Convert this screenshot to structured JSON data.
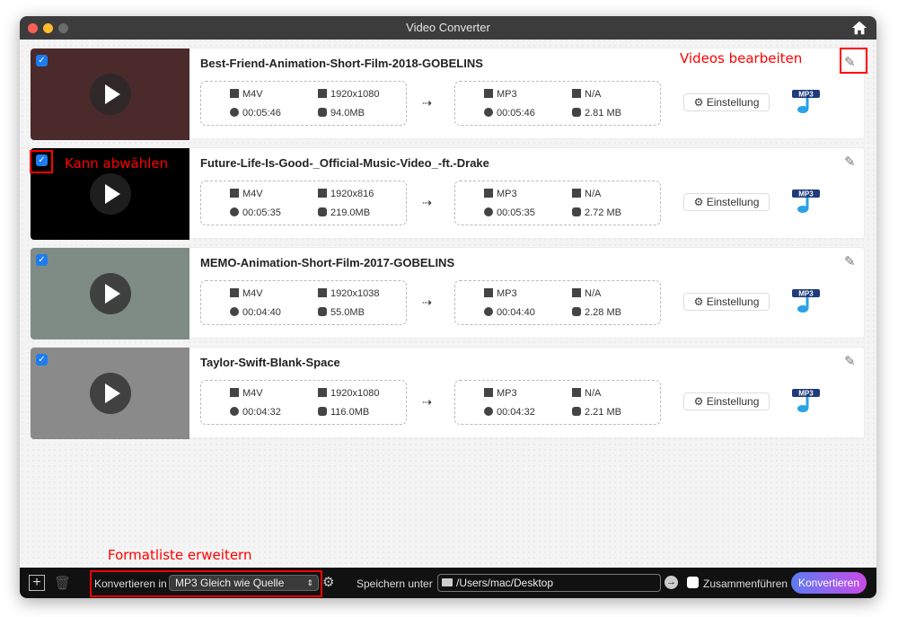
{
  "window": {
    "title": "Video Converter"
  },
  "items": [
    {
      "title": "Best-Friend-Animation-Short-Film-2018-GOBELINS",
      "src": {
        "format": "M4V",
        "resolution": "1920x1080",
        "duration": "00:05:46",
        "size": "94.0MB"
      },
      "dst": {
        "format": "MP3",
        "resolution": "N/A",
        "duration": "00:05:46",
        "size": "2.81 MB"
      },
      "thumb_color": "#4a2a2a"
    },
    {
      "title": "Future-Life-Is-Good-_Official-Music-Video_-ft.-Drake",
      "src": {
        "format": "M4V",
        "resolution": "1920x816",
        "duration": "00:05:35",
        "size": "219.0MB"
      },
      "dst": {
        "format": "MP3",
        "resolution": "N/A",
        "duration": "00:05:35",
        "size": "2.72 MB"
      },
      "thumb_color": "#000000"
    },
    {
      "title": "MEMO-Animation-Short-Film-2017-GOBELINS",
      "src": {
        "format": "M4V",
        "resolution": "1920x1038",
        "duration": "00:04:40",
        "size": "55.0MB"
      },
      "dst": {
        "format": "MP3",
        "resolution": "N/A",
        "duration": "00:04:40",
        "size": "2.28 MB"
      },
      "thumb_color": "#7f8c86"
    },
    {
      "title": "Taylor-Swift-Blank-Space",
      "src": {
        "format": "M4V",
        "resolution": "1920x1080",
        "duration": "00:04:32",
        "size": "116.0MB"
      },
      "dst": {
        "format": "MP3",
        "resolution": "N/A",
        "duration": "00:04:32",
        "size": "2.21 MB"
      },
      "thumb_color": "#8a8a8a"
    }
  ],
  "settings_label": "Einstellung",
  "mp3_badge": "MP3",
  "annotations": {
    "edit": "Videos bearbeiten",
    "uncheck": "Kann abwählen",
    "formats": "Formatliste erweitern"
  },
  "bottom": {
    "convert_to_label": "Konvertieren in",
    "format_value": "MP3 Gleich wie Quelle",
    "save_label": "Speichern unter",
    "path": "/Users/mac/Desktop",
    "merge_label": "Zusammenführen",
    "convert_button": "Konvertieren"
  }
}
